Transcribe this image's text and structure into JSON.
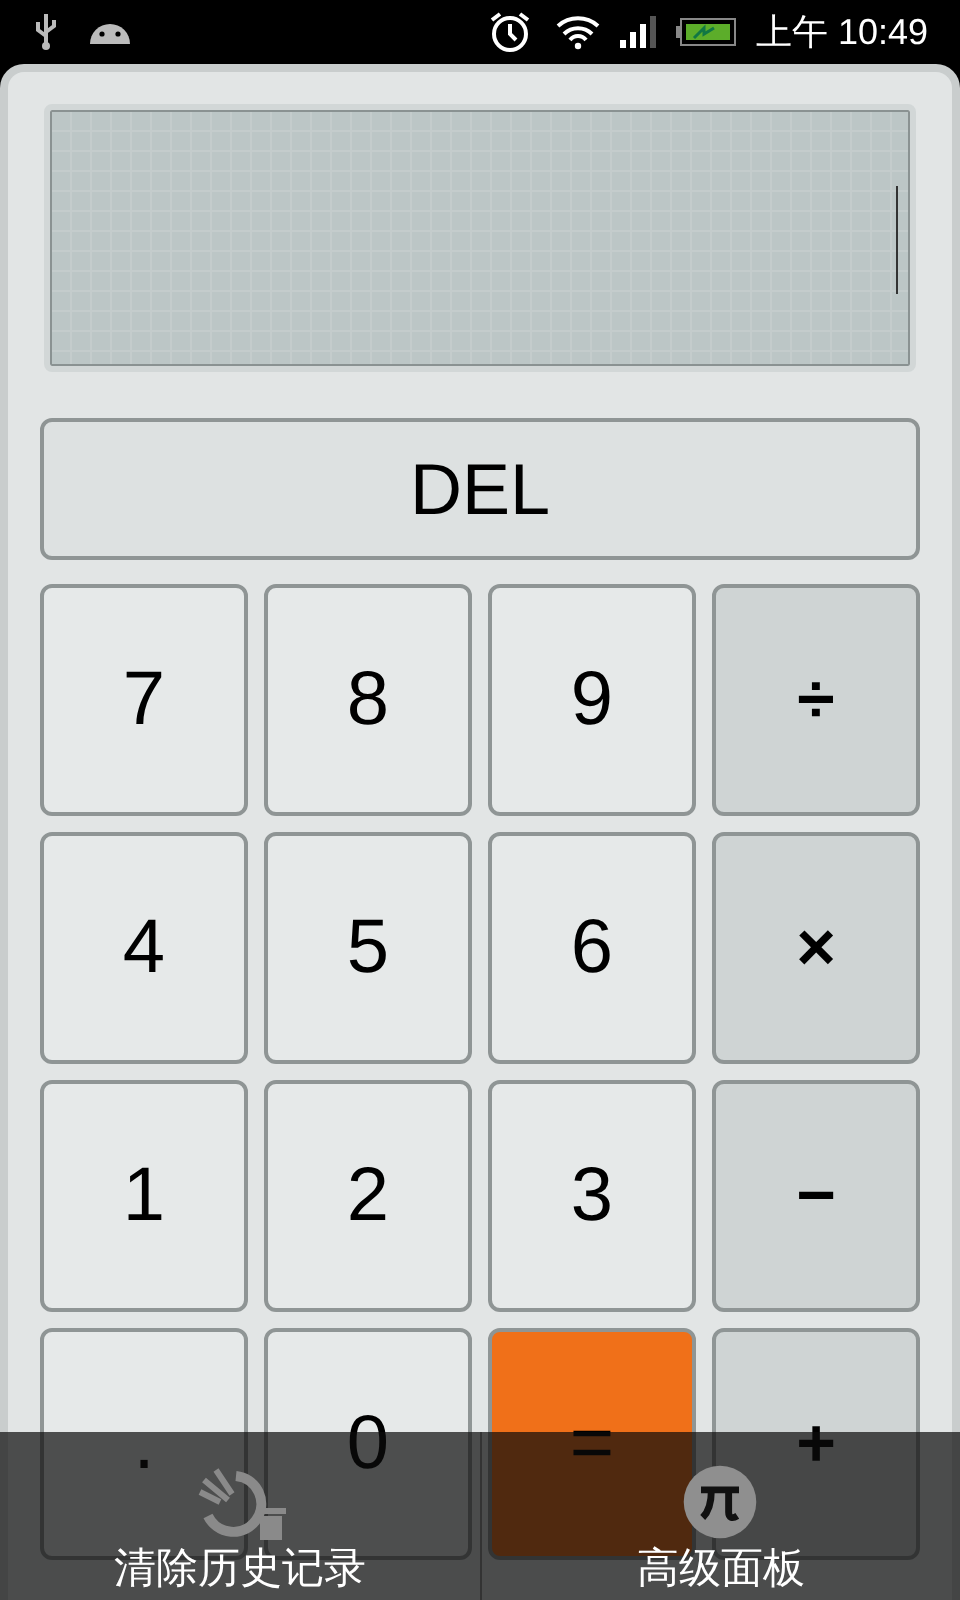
{
  "status_bar": {
    "time": "上午 10:49"
  },
  "display": {
    "cursor": true
  },
  "delete_key": {
    "label": "DEL"
  },
  "keys": [
    {
      "label": "7",
      "kind": "digit"
    },
    {
      "label": "8",
      "kind": "digit"
    },
    {
      "label": "9",
      "kind": "digit"
    },
    {
      "label": "÷",
      "kind": "operator"
    },
    {
      "label": "4",
      "kind": "digit"
    },
    {
      "label": "5",
      "kind": "digit"
    },
    {
      "label": "6",
      "kind": "digit"
    },
    {
      "label": "×",
      "kind": "operator"
    },
    {
      "label": "1",
      "kind": "digit"
    },
    {
      "label": "2",
      "kind": "digit"
    },
    {
      "label": "3",
      "kind": "digit"
    },
    {
      "label": "−",
      "kind": "operator"
    },
    {
      "label": ".",
      "kind": "digit"
    },
    {
      "label": "0",
      "kind": "digit"
    },
    {
      "label": "=",
      "kind": "equals"
    },
    {
      "label": "+",
      "kind": "operator"
    }
  ],
  "menu": [
    {
      "label": "清除历史记录",
      "kind": "clear-history"
    },
    {
      "label": "高级面板",
      "kind": "advanced"
    }
  ]
}
